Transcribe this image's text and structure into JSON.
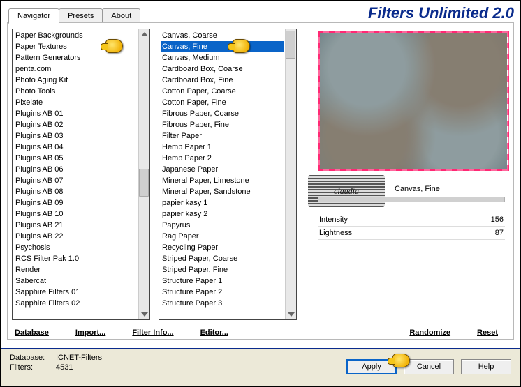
{
  "app_title": "Filters Unlimited 2.0",
  "tabs": [
    "Navigator",
    "Presets",
    "About"
  ],
  "active_tab": 0,
  "categories": [
    "Paper Backgrounds",
    "Paper Textures",
    "Pattern Generators",
    "penta.com",
    "Photo Aging Kit",
    "Photo Tools",
    "Pixelate",
    "Plugins AB 01",
    "Plugins AB 02",
    "Plugins AB 03",
    "Plugins AB 04",
    "Plugins AB 05",
    "Plugins AB 06",
    "Plugins AB 07",
    "Plugins AB 08",
    "Plugins AB 09",
    "Plugins AB 10",
    "Plugins AB 21",
    "Plugins AB 22",
    "Psychosis",
    "RCS Filter Pak 1.0",
    "Render",
    "Sabercat",
    "Sapphire Filters 01",
    "Sapphire Filters 02"
  ],
  "selected_category": "Paper Textures",
  "filters": [
    "Canvas, Coarse",
    "Canvas, Fine",
    "Canvas, Medium",
    "Cardboard Box, Coarse",
    "Cardboard Box, Fine",
    "Cotton Paper, Coarse",
    "Cotton Paper, Fine",
    "Fibrous Paper, Coarse",
    "Fibrous Paper, Fine",
    "Filter Paper",
    "Hemp Paper 1",
    "Hemp Paper 2",
    "Japanese Paper",
    "Mineral Paper, Limestone",
    "Mineral Paper, Sandstone",
    "papier kasy 1",
    "papier kasy 2",
    "Papyrus",
    "Rag Paper",
    "Recycling Paper",
    "Striped Paper, Coarse",
    "Striped Paper, Fine",
    "Structure Paper 1",
    "Structure Paper 2",
    "Structure Paper 3"
  ],
  "selected_filter_index": 1,
  "current_filter_name": "Canvas, Fine",
  "watermark_text": "claudia",
  "params": [
    {
      "label": "Intensity",
      "value": 156
    },
    {
      "label": "Lightness",
      "value": 87
    }
  ],
  "links": {
    "database": "Database",
    "import": "Import...",
    "filter_info": "Filter Info...",
    "editor": "Editor...",
    "randomize": "Randomize",
    "reset": "Reset"
  },
  "status": {
    "database_label": "Database:",
    "database_value": "ICNET-Filters",
    "filters_label": "Filters:",
    "filters_value": "4531"
  },
  "buttons": {
    "apply": "Apply",
    "cancel": "Cancel",
    "help": "Help"
  }
}
